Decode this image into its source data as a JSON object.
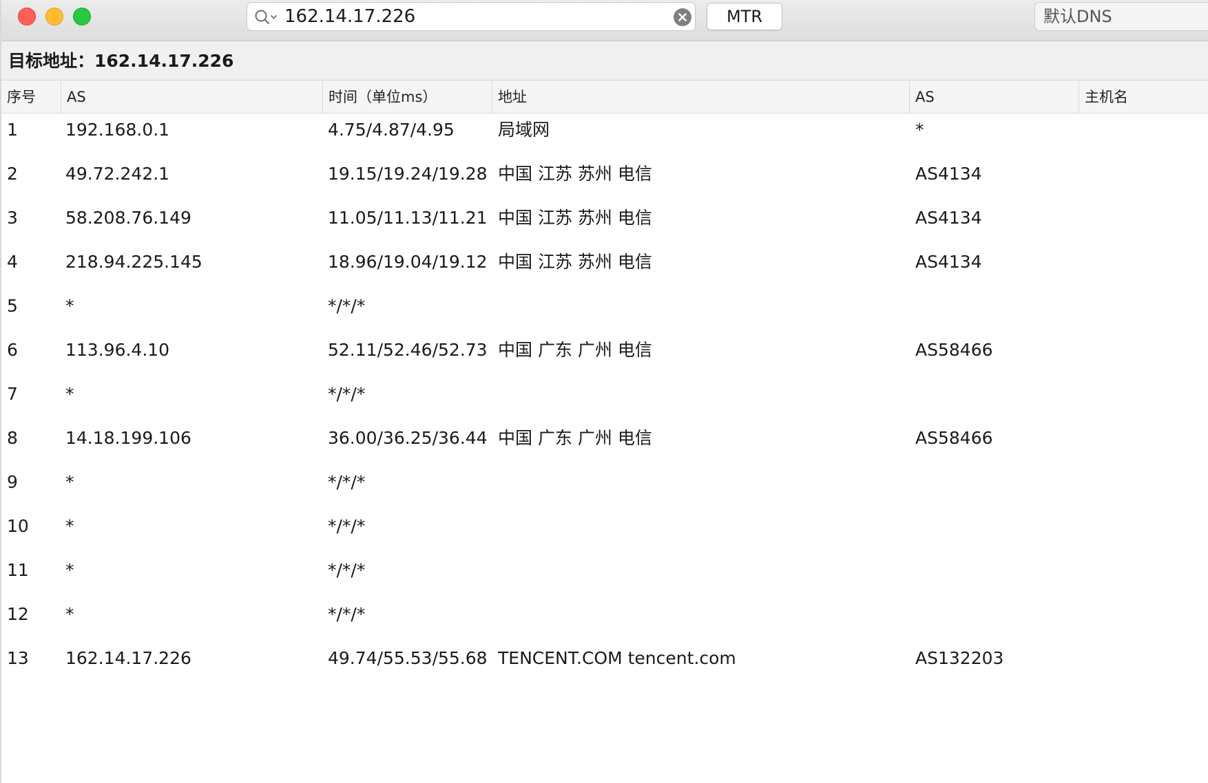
{
  "toolbar": {
    "search_value": "162.14.17.226",
    "mtr_label": "MTR",
    "dns_selected": "默认DNS"
  },
  "target": {
    "label": "目标地址：162.14.17.226"
  },
  "table": {
    "headers": [
      "序号",
      "AS",
      "时间（单位ms）",
      "地址",
      "AS",
      "主机名"
    ],
    "rows": [
      [
        "1",
        "192.168.0.1",
        "4.75/4.87/4.95",
        "局域网",
        "*",
        ""
      ],
      [
        "2",
        "49.72.242.1",
        "19.15/19.24/19.28",
        "中国 江苏 苏州 电信",
        "AS4134",
        ""
      ],
      [
        "3",
        "58.208.76.149",
        "11.05/11.13/11.21",
        "中国 江苏 苏州 电信",
        "AS4134",
        ""
      ],
      [
        "4",
        "218.94.225.145",
        "18.96/19.04/19.12",
        "中国 江苏 苏州 电信",
        "AS4134",
        ""
      ],
      [
        "5",
        "*",
        "*/*/*",
        "",
        "",
        ""
      ],
      [
        "6",
        "113.96.4.10",
        "52.11/52.46/52.73",
        "中国 广东 广州 电信",
        "AS58466",
        ""
      ],
      [
        "7",
        "*",
        "*/*/*",
        "",
        "",
        ""
      ],
      [
        "8",
        "14.18.199.106",
        "36.00/36.25/36.44",
        "中国 广东 广州 电信",
        "AS58466",
        ""
      ],
      [
        "9",
        "*",
        "*/*/*",
        "",
        "",
        ""
      ],
      [
        "10",
        "*",
        "*/*/*",
        "",
        "",
        ""
      ],
      [
        "11",
        "*",
        "*/*/*",
        "",
        "",
        ""
      ],
      [
        "12",
        "*",
        "*/*/*",
        "",
        "",
        ""
      ],
      [
        "13",
        "162.14.17.226",
        "49.74/55.53/55.68",
        "TENCENT.COM tencent.com",
        "AS132203",
        ""
      ]
    ]
  },
  "icons": {
    "search": "search-icon",
    "clear": "clear-icon"
  },
  "colors": {
    "close": "#fe5f57",
    "minimize": "#febc2e",
    "maximize": "#28c840"
  }
}
